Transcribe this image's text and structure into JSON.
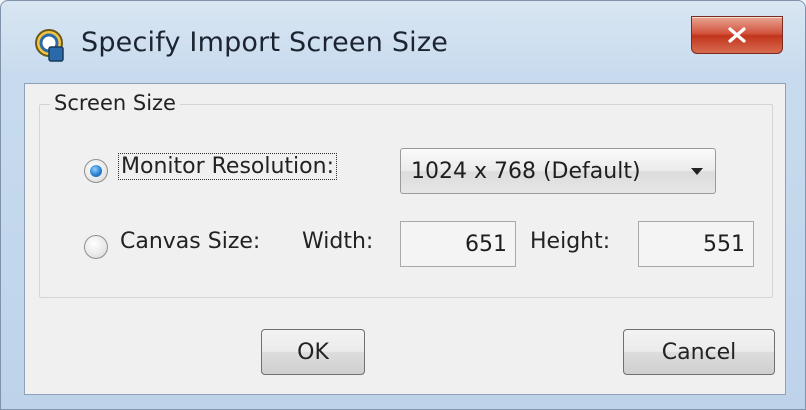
{
  "window": {
    "title": "Specify Import Screen Size",
    "close_glyph": "X"
  },
  "group": {
    "title": "Screen Size"
  },
  "options": {
    "monitor_label": "Monitor Resolution:",
    "monitor_selected": true,
    "resolution_value": "1024 x 768 (Default)",
    "canvas_label": "Canvas Size:",
    "canvas_selected": false,
    "width_label": "Width:",
    "width_value": "651",
    "height_label": "Height:",
    "height_value": "551"
  },
  "buttons": {
    "ok": "OK",
    "cancel": "Cancel"
  },
  "colors": {
    "close_button": "#c2351c",
    "radio_selected": "#2a7fd0",
    "titlebar": "#c8dbee"
  }
}
